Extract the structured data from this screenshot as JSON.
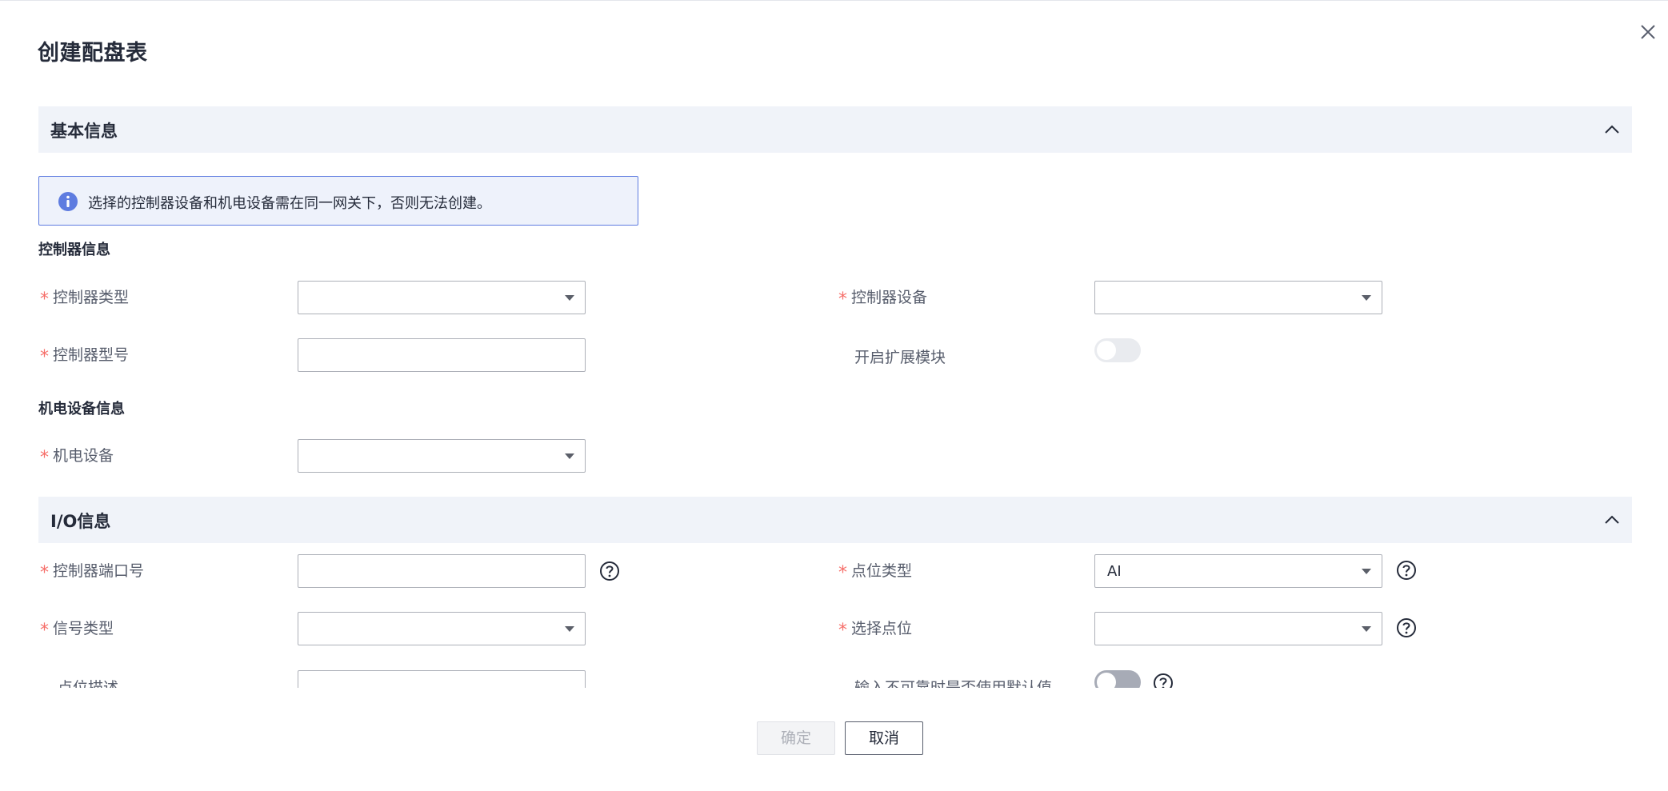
{
  "dialog": {
    "title": "创建配盘表"
  },
  "basic": {
    "section_title": "基本信息",
    "info": "选择的控制器设备和机电设备需在同一网关下，否则无法创建。",
    "controller_heading": "控制器信息",
    "controller_type_label": "控制器类型",
    "controller_device_label": "控制器设备",
    "controller_model_label": "控制器型号",
    "expansion_label": "开启扩展模块",
    "mech_heading": "机电设备信息",
    "mech_device_label": "机电设备"
  },
  "io": {
    "section_title": "I/O信息",
    "port_label": "控制器端口号",
    "point_type_label": "点位类型",
    "point_type_value": "AI",
    "signal_type_label": "信号类型",
    "select_point_label": "选择点位",
    "point_desc_label": "点位描述",
    "default_value_label": "输入不可靠时是否使用默认值"
  },
  "required_mark": "*",
  "footer": {
    "ok_label": "确定",
    "cancel_label": "取消"
  },
  "colors": {
    "accent": "#5e7ce0",
    "required": "#f66f6a",
    "section_bg": "#f0f3f9"
  },
  "icons": {
    "close": "close-icon",
    "collapse": "chevron-up-icon",
    "info": "info-icon",
    "help": "question-circle-icon",
    "dropdown": "caret-down-icon"
  }
}
